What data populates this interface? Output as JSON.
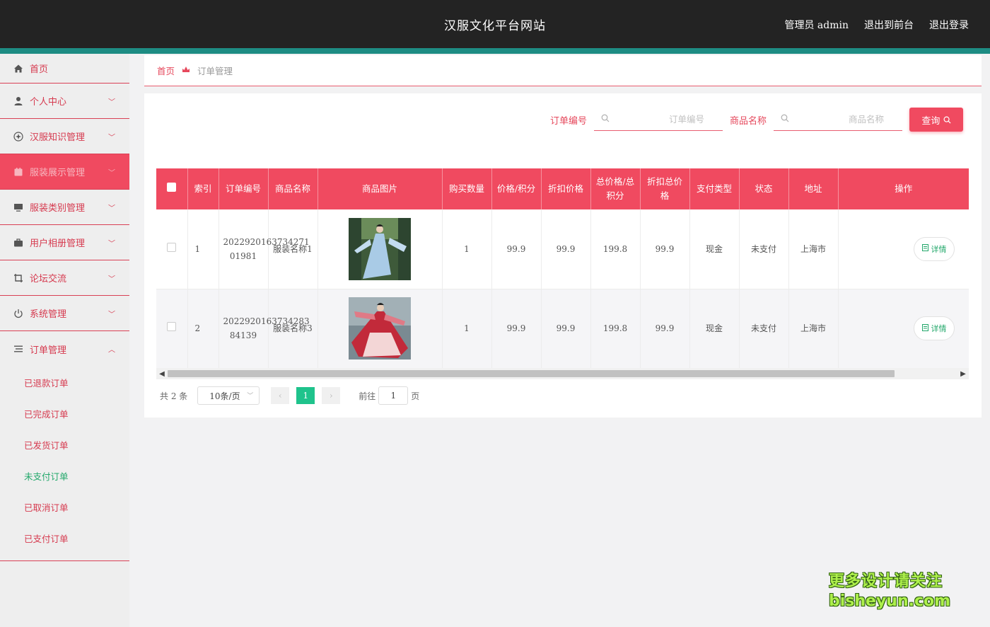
{
  "header": {
    "title": "汉服文化平台网站",
    "admin_label": "管理员 admin",
    "to_front": "退出到前台",
    "logout": "退出登录",
    "accent_color": "#1d8c83"
  },
  "sidebar": {
    "items": [
      {
        "label": "首页",
        "icon": "home-icon"
      },
      {
        "label": "个人中心",
        "icon": "user-icon"
      },
      {
        "label": "汉服知识管理",
        "icon": "compass-icon"
      },
      {
        "label": "服装展示管理",
        "icon": "calendar-icon"
      },
      {
        "label": "服装类别管理",
        "icon": "monitor-icon"
      },
      {
        "label": "用户相册管理",
        "icon": "briefcase-icon"
      },
      {
        "label": "论坛交流",
        "icon": "crop-icon"
      },
      {
        "label": "系统管理",
        "icon": "power-icon"
      },
      {
        "label": "订单管理",
        "icon": "list-icon"
      }
    ],
    "sub_items": [
      "已退款订单",
      "已完成订单",
      "已发货订单",
      "未支付订单",
      "已取消订单",
      "已支付订单"
    ]
  },
  "breadcrumb": {
    "home": "首页",
    "current": "订单管理"
  },
  "search": {
    "order_label": "订单编号",
    "order_placeholder": "订单编号",
    "name_label": "商品名称",
    "name_placeholder": "商品名称",
    "query_button": "查询"
  },
  "table": {
    "headers": [
      "索引",
      "订单编号",
      "商品名称",
      "商品图片",
      "购买数量",
      "价格/积分",
      "折扣价格",
      "总价格/总积分",
      "折扣总价格",
      "支付类型",
      "状态",
      "地址",
      "操作"
    ],
    "rows": [
      {
        "index": "1",
        "order_no": "2022920163734271 01981",
        "name": "服装名称1",
        "qty": "1",
        "price": "99.9",
        "discount": "99.9",
        "total": "199.8",
        "discount_total": "99.9",
        "pay_type": "现金",
        "status": "未支付",
        "address": "上海市",
        "action": "详情"
      },
      {
        "index": "2",
        "order_no": "2022920163734283 84139",
        "name": "服装名称3",
        "qty": "1",
        "price": "99.9",
        "discount": "99.9",
        "total": "199.8",
        "discount_total": "99.9",
        "pay_type": "现金",
        "status": "未支付",
        "address": "上海市",
        "action": "详情"
      }
    ]
  },
  "pagination": {
    "total": "共 2 条",
    "page_size": "10条/页",
    "current_page": "1",
    "goto_prefix": "前往",
    "goto_value": "1",
    "goto_suffix": "页"
  },
  "watermark": {
    "line1": "更多设计请关注",
    "line2": "bisheyun.com"
  }
}
